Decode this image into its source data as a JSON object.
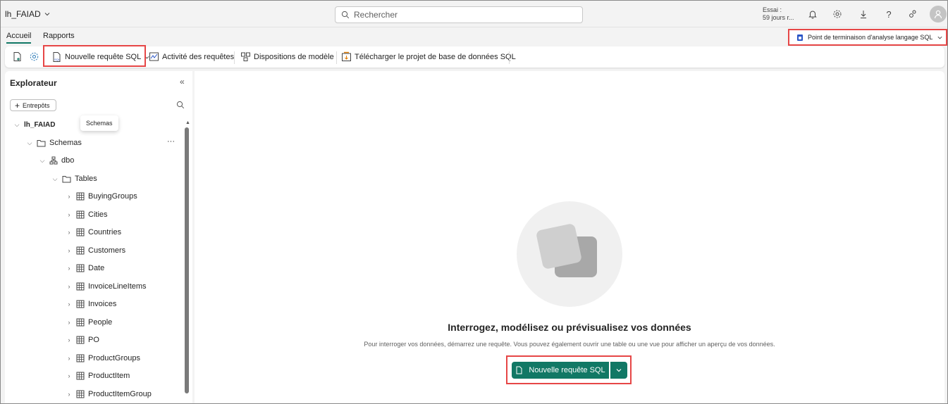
{
  "topbar": {
    "workspace": "lh_FAIAD",
    "search_placeholder": "Rechercher",
    "trial_line1": "Essai :",
    "trial_line2": "59 jours r..."
  },
  "tabs": [
    {
      "label": "Accueil",
      "active": true
    },
    {
      "label": "Rapports",
      "active": false
    }
  ],
  "endpoint": {
    "label": "Point de terminaison d'analyse langage SQL"
  },
  "ribbon": {
    "new_sql": "Nouvelle requête SQL",
    "activity": "Activité des requêtes",
    "layouts": "Dispositions de modèle",
    "download": "Télécharger le projet de base de données SQL"
  },
  "explorer": {
    "title": "Explorateur",
    "warehouses_button": "Entrepôts",
    "tooltip": "Schemas",
    "root": "lh_FAIAD",
    "schemas": "Schemas",
    "dbo": "dbo",
    "tables_folder": "Tables",
    "tables": [
      "BuyingGroups",
      "Cities",
      "Countries",
      "Customers",
      "Date",
      "InvoiceLineItems",
      "Invoices",
      "People",
      "PO",
      "ProductGroups",
      "ProductItem",
      "ProductItemGroup"
    ]
  },
  "main": {
    "heading": "Interrogez, modélisez ou prévisualisez vos données",
    "subtext": "Pour interroger vos données, démarrez une requête. Vous pouvez également ouvrir une table ou une vue pour afficher un aperçu de vos données.",
    "cta_label": "Nouvelle requête SQL"
  },
  "colors": {
    "accent": "#117865",
    "highlight": "#e64646"
  }
}
